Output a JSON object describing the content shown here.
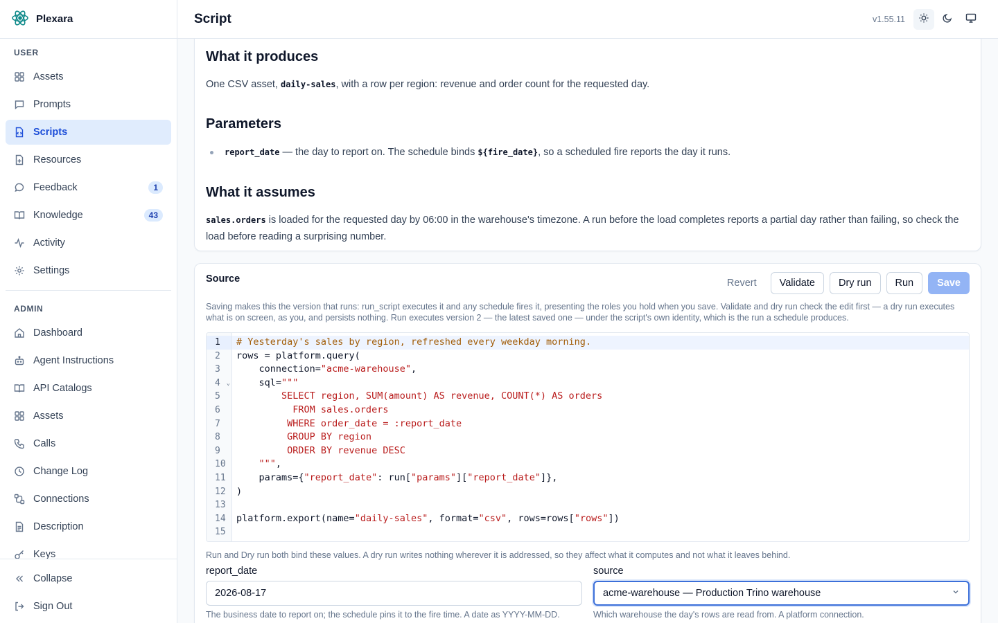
{
  "app": {
    "name": "Plexara",
    "version": "v1.55.11"
  },
  "header": {
    "title": "Script"
  },
  "sidebar": {
    "user_label": "USER",
    "user_items": [
      {
        "label": "Assets",
        "icon": "grid-icon"
      },
      {
        "label": "Prompts",
        "icon": "message-square-icon"
      },
      {
        "label": "Scripts",
        "icon": "file-code-icon",
        "active": true
      },
      {
        "label": "Resources",
        "icon": "file-plus-icon"
      },
      {
        "label": "Feedback",
        "icon": "message-circle-icon",
        "badge": "1"
      },
      {
        "label": "Knowledge",
        "icon": "book-open-icon",
        "badge": "43"
      },
      {
        "label": "Activity",
        "icon": "activity-icon"
      },
      {
        "label": "Settings",
        "icon": "gear-icon"
      }
    ],
    "admin_label": "ADMIN",
    "admin_items": [
      {
        "label": "Dashboard",
        "icon": "home-icon"
      },
      {
        "label": "Agent Instructions",
        "icon": "bot-icon"
      },
      {
        "label": "API Catalogs",
        "icon": "book-icon"
      },
      {
        "label": "Assets",
        "icon": "grid-icon"
      },
      {
        "label": "Calls",
        "icon": "phone-icon"
      },
      {
        "label": "Change Log",
        "icon": "clock-icon"
      },
      {
        "label": "Connections",
        "icon": "connections-icon"
      },
      {
        "label": "Description",
        "icon": "file-text-icon"
      },
      {
        "label": "Keys",
        "icon": "key-icon"
      }
    ],
    "footer": {
      "collapse": "Collapse",
      "signout": "Sign Out"
    }
  },
  "doc": {
    "produces_title": "What it produces",
    "produces_pre": "One CSV asset, ",
    "produces_code": "daily-sales",
    "produces_post": ", with a row per region: revenue and order count for the requested day.",
    "params_title": "Parameters",
    "param_code": "report_date",
    "param_mid": " — the day to report on. The schedule binds ",
    "param_code2": "${fire_date}",
    "param_post": ", so a scheduled fire reports the day it runs.",
    "assumes_title": "What it assumes",
    "assumes_code": "sales.orders",
    "assumes_text": " is loaded for the requested day by 06:00 in the warehouse's timezone. A run before the load completes reports a partial day rather than failing, so check the load before reading a surprising number."
  },
  "source": {
    "title": "Source",
    "revert": "Revert",
    "validate": "Validate",
    "dryrun": "Dry run",
    "run": "Run",
    "save": "Save",
    "help": "Saving makes this the version that runs: run_script executes it and any schedule fires it, presenting the roles you hold when you save. Validate and dry run check the edit first — a dry run executes what is on screen, as you, and persists nothing. Run executes version 2 — the latest saved one — under the script's own identity, which is the run a schedule produces.",
    "code_lines": [
      [
        {
          "t": "# Yesterday's sales by region, refreshed every weekday morning.",
          "c": "cm"
        }
      ],
      [
        {
          "t": "rows = platform.query("
        }
      ],
      [
        {
          "t": "    connection="
        },
        {
          "t": "\"acme-warehouse\"",
          "c": "st"
        },
        {
          "t": ","
        }
      ],
      [
        {
          "t": "    sql="
        },
        {
          "t": "\"\"\"",
          "c": "st"
        }
      ],
      [
        {
          "t": "        SELECT region, SUM(amount) AS revenue, COUNT(*) AS orders",
          "c": "st"
        }
      ],
      [
        {
          "t": "          FROM sales.orders",
          "c": "st"
        }
      ],
      [
        {
          "t": "         WHERE order_date = :report_date",
          "c": "st"
        }
      ],
      [
        {
          "t": "         GROUP BY region",
          "c": "st"
        }
      ],
      [
        {
          "t": "         ORDER BY revenue DESC",
          "c": "st"
        }
      ],
      [
        {
          "t": "    \"\"\"",
          "c": "st"
        },
        {
          "t": ","
        }
      ],
      [
        {
          "t": "    params={"
        },
        {
          "t": "\"report_date\"",
          "c": "st"
        },
        {
          "t": ": run["
        },
        {
          "t": "\"params\"",
          "c": "st"
        },
        {
          "t": "]["
        },
        {
          "t": "\"report_date\"",
          "c": "st"
        },
        {
          "t": "]},"
        }
      ],
      [
        {
          "t": ")"
        }
      ],
      [
        {
          "t": ""
        }
      ],
      [
        {
          "t": "platform.export(name="
        },
        {
          "t": "\"daily-sales\"",
          "c": "st"
        },
        {
          "t": ", format="
        },
        {
          "t": "\"csv\"",
          "c": "st"
        },
        {
          "t": ", rows=rows["
        },
        {
          "t": "\"rows\"",
          "c": "st"
        },
        {
          "t": "])"
        }
      ],
      [
        {
          "t": ""
        }
      ]
    ],
    "params_note": "Run and Dry run both bind these values. A dry run writes nothing wherever it is addressed, so they affect what it computes and not what it leaves behind.",
    "report_date_label": "report_date",
    "report_date_value": "2026-08-17",
    "report_date_help": "The business date to report on; the schedule pins it to the fire time. A date as YYYY-MM-DD.",
    "source_label": "source",
    "source_value": "acme-warehouse — Production Trino warehouse",
    "source_help": "Which warehouse the day's rows are read from. A platform connection."
  }
}
